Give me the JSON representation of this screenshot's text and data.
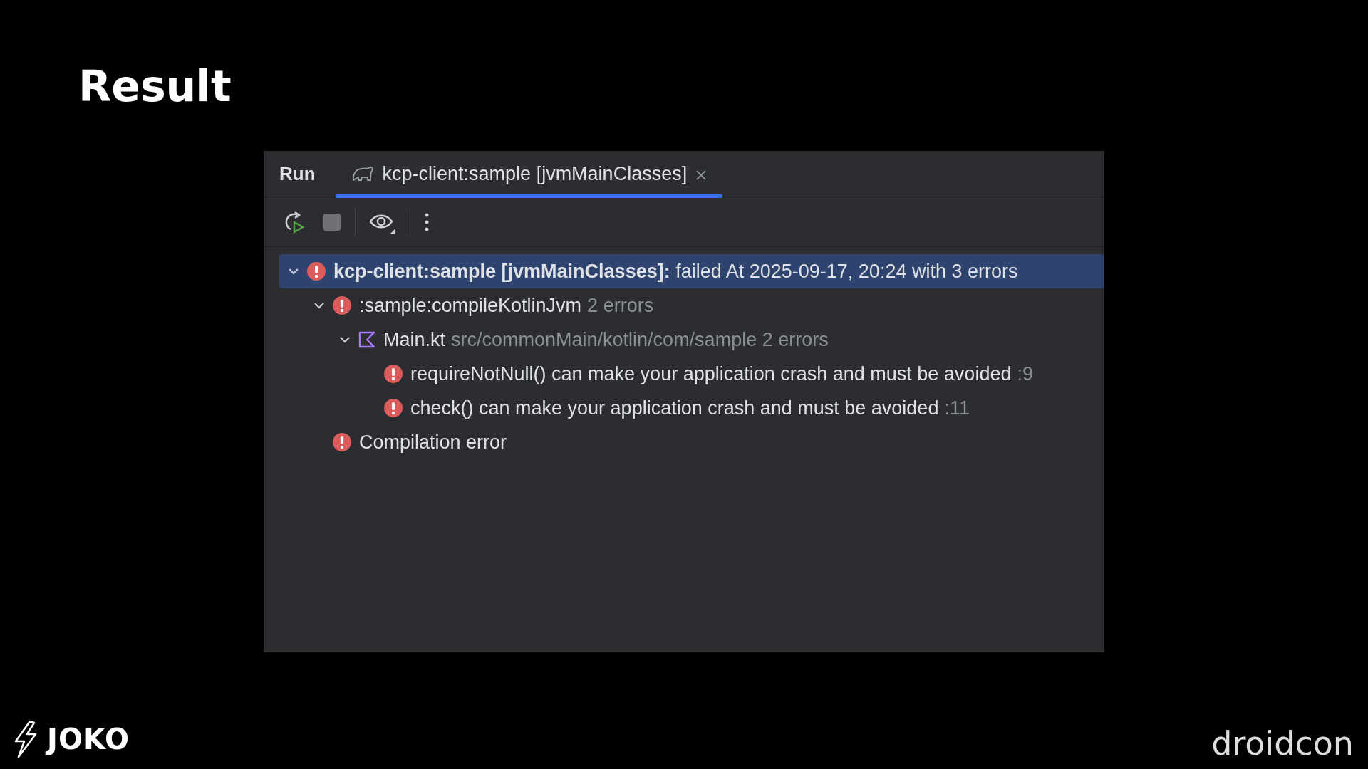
{
  "slide_title": "Result",
  "panel": {
    "title": "Run",
    "tabs": [
      {
        "label": "kcp-client:sample [jvmMainClasses]",
        "selected": true
      }
    ],
    "tree": [
      {
        "kind": "error",
        "label": "**kcp-client:sample [jvmMainClasses]:** failed At 2025-09-17, 20:24 with 3 errors",
        "selected": true,
        "expanded": true,
        "children": [
          {
            "kind": "error",
            "label": ":sample:compileKotlinJvm",
            "detail": "2 errors",
            "selected": false,
            "expanded": true,
            "children": [
              {
                "kind": "file",
                "label": "Main.kt",
                "detail": "src/commonMain/kotlin/com/sample 2 errors",
                "selected": false,
                "expanded": true,
                "children": [
                  {
                    "kind": "error",
                    "label": "requireNotNull() can make your application crash and must be avoided",
                    "detail": ":9",
                    "selected": false
                  },
                  {
                    "kind": "error",
                    "label": "check() can make your application crash and must be avoided",
                    "detail": ":11",
                    "selected": false
                  }
                ]
              }
            ]
          },
          {
            "kind": "error",
            "label": "Compilation error",
            "selected": false
          }
        ]
      }
    ]
  },
  "footer": {
    "left_logo": "JOKO",
    "right_logo": "droidcon"
  }
}
